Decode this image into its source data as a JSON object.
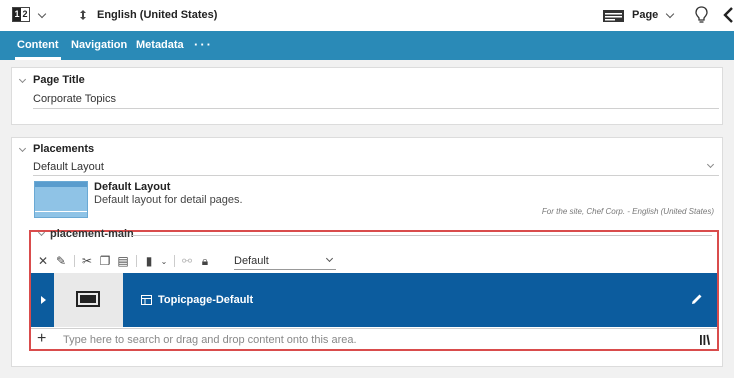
{
  "toolbar": {
    "lang_toggle": {
      "left": "1",
      "right": "2"
    },
    "language": "English (United States)",
    "view_mode": "Page"
  },
  "tabs": [
    {
      "label": "Content"
    },
    {
      "label": "Navigation"
    },
    {
      "label": "Metadata"
    }
  ],
  "tabs_more": "···",
  "page_title_section": {
    "title": "Page Title",
    "value": "Corporate Topics"
  },
  "placements_section": {
    "title": "Placements",
    "layout_select": "Default Layout",
    "layout_name": "Default Layout",
    "layout_description": "Default layout for detail pages.",
    "site_note": "For the site, Chef Corp. - English (United States)",
    "placement": {
      "name": "placement-main",
      "view_type": "Default",
      "item_label": "Topicpage-Default",
      "drop_placeholder": "Type here to search or drag and drop content onto this area."
    }
  },
  "colors": {
    "tab_bar": "#2a8ab7",
    "selected_item": "#0c5c9e",
    "highlight_border": "#d94c4c"
  }
}
